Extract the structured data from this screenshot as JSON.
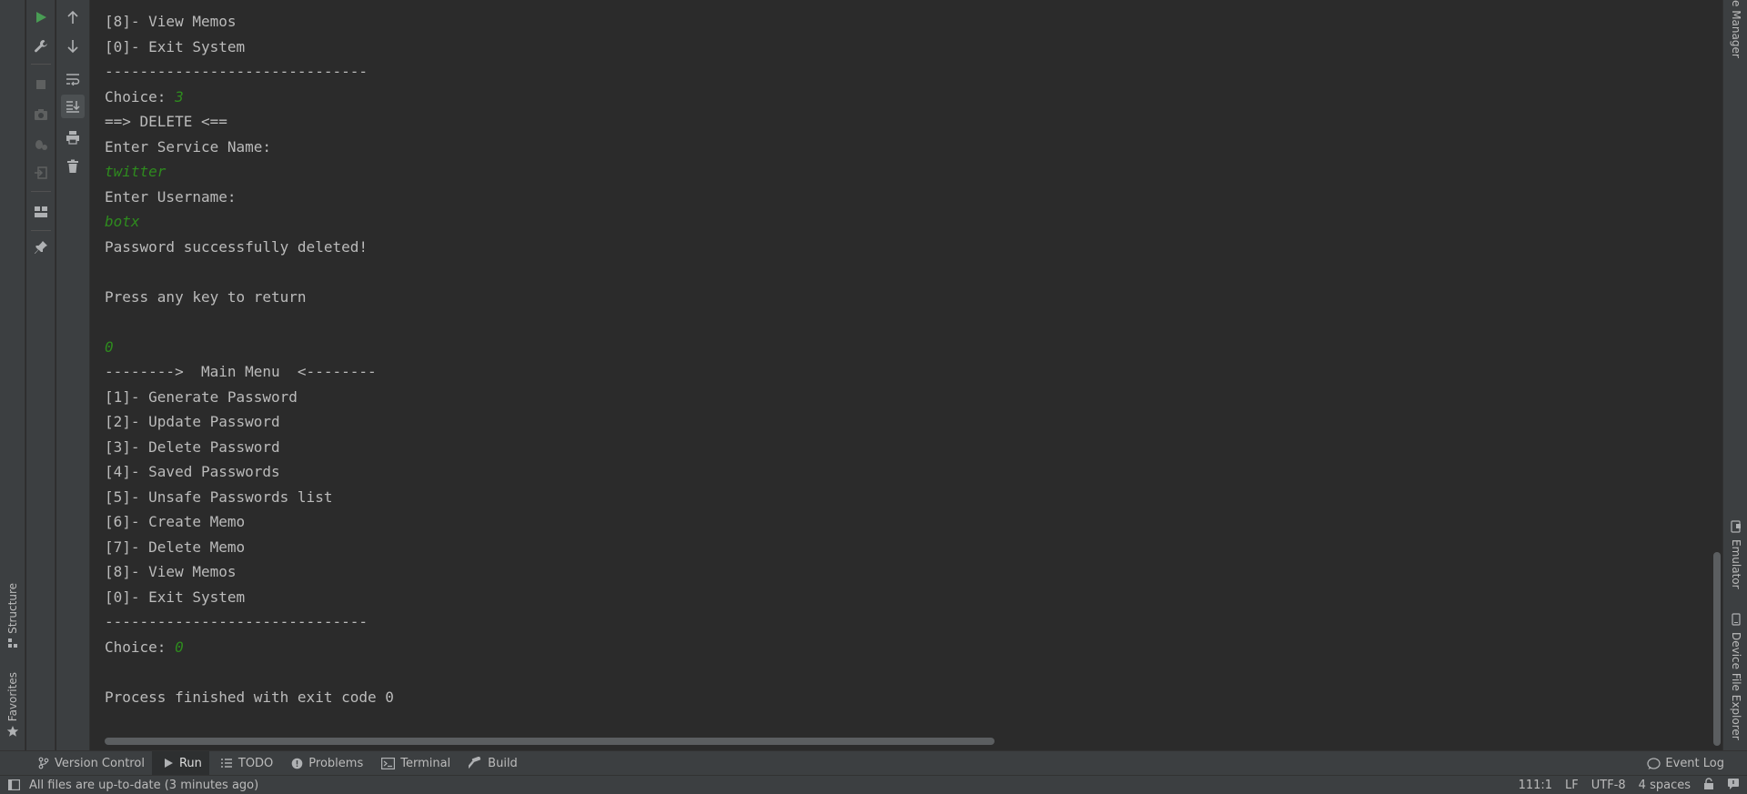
{
  "left_strip": {
    "structure_label": "Structure",
    "favorites_label": "Favorites"
  },
  "console": {
    "lines": [
      {
        "text": "[8]- View Memos"
      },
      {
        "text": "[0]- Exit System"
      },
      {
        "text": "------------------------------"
      },
      {
        "text": "Choice: ",
        "input": "3"
      },
      {
        "text": "==> DELETE <=="
      },
      {
        "text": "Enter Service Name:"
      },
      {
        "text": "",
        "input": "twitter"
      },
      {
        "text": "Enter Username:"
      },
      {
        "text": "",
        "input": "botx"
      },
      {
        "text": "Password successfully deleted!"
      },
      {
        "text": ""
      },
      {
        "text": "Press any key to return"
      },
      {
        "text": ""
      },
      {
        "text": "",
        "input": "0"
      },
      {
        "text": "-------->  Main Menu  <--------"
      },
      {
        "text": "[1]- Generate Password"
      },
      {
        "text": "[2]- Update Password"
      },
      {
        "text": "[3]- Delete Password"
      },
      {
        "text": "[4]- Saved Passwords"
      },
      {
        "text": "[5]- Unsafe Passwords list"
      },
      {
        "text": "[6]- Create Memo"
      },
      {
        "text": "[7]- Delete Memo"
      },
      {
        "text": "[8]- View Memos"
      },
      {
        "text": "[0]- Exit System"
      },
      {
        "text": "------------------------------"
      },
      {
        "text": "Choice: ",
        "input": "0"
      },
      {
        "text": ""
      },
      {
        "text": "Process finished with exit code 0"
      }
    ]
  },
  "right_strip": {
    "manager_label": "e Manager",
    "emulator_label": "Emulator",
    "device_label": "Device File Explorer"
  },
  "bottom_bar": {
    "tabs": [
      {
        "label": "Version Control",
        "icon": "branch-icon"
      },
      {
        "label": "Run",
        "icon": "run-icon",
        "active": true
      },
      {
        "label": "TODO",
        "icon": "list-icon"
      },
      {
        "label": "Problems",
        "icon": "info-icon"
      },
      {
        "label": "Terminal",
        "icon": "terminal-icon"
      },
      {
        "label": "Build",
        "icon": "hammer-icon"
      }
    ],
    "event_log": "Event Log"
  },
  "status_bar": {
    "message": "All files are up-to-date (3 minutes ago)",
    "position": "111:1",
    "line_separator": "LF",
    "encoding": "UTF-8",
    "indent": "4 spaces"
  },
  "colors": {
    "background": "#2b2b2b",
    "panel": "#3c3f41",
    "text": "#bbbbbb",
    "input_text": "#2e8b1e",
    "run_green": "#499c54"
  }
}
